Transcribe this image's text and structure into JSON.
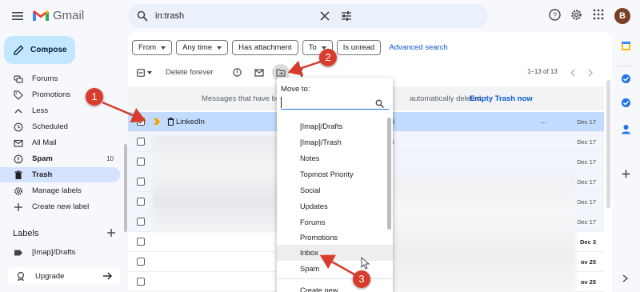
{
  "app": {
    "name": "Gmail",
    "avatar_letter": "B"
  },
  "search": {
    "query": "in:trash"
  },
  "compose": {
    "label": "Compose"
  },
  "sidebar": {
    "items": [
      {
        "label": "Forums",
        "icon": "forums-icon"
      },
      {
        "label": "Promotions",
        "icon": "tag-icon"
      },
      {
        "label": "Less",
        "icon": "chevron-up-icon"
      },
      {
        "label": "Scheduled",
        "icon": "schedule-icon"
      },
      {
        "label": "All Mail",
        "icon": "all-mail-icon"
      },
      {
        "label": "Spam",
        "icon": "spam-icon",
        "count": "10"
      },
      {
        "label": "Trash",
        "icon": "trash-icon"
      },
      {
        "label": "Manage labels",
        "icon": "gear-icon"
      },
      {
        "label": "Create new label",
        "icon": "plus-icon"
      }
    ],
    "labels_heading": "Labels",
    "label_items": [
      {
        "label": "[Imap]/Drafts",
        "icon": "label-icon"
      }
    ],
    "upgrade": "Upgrade"
  },
  "filters": {
    "from": "From",
    "any_time": "Any time",
    "has_attachment": "Has attachment",
    "to": "To",
    "is_unread": "Is unread",
    "advanced": "Advanced search"
  },
  "toolbar": {
    "delete_forever": "Delete forever",
    "pager": "1–13 of 13"
  },
  "banner": {
    "text_left": "Messages that have be",
    "text_right": "automatically deleted.",
    "empty_trash": "Empty Trash now"
  },
  "emails": [
    {
      "sender": "LinkedIn",
      "tail": "d",
      "ellipsis": "...",
      "date": "Dec 17",
      "selected": true
    },
    {
      "sender": "",
      "tail": "s",
      "date": "Dec 17"
    },
    {
      "sender": "",
      "tail": "",
      "date": "Dec 17"
    },
    {
      "sender": "",
      "tail": "",
      "date": "Dec 17"
    },
    {
      "sender": "",
      "tail": "",
      "date": "Dec 17"
    },
    {
      "sender": "",
      "tail": "",
      "date": "Dec 17"
    },
    {
      "sender": "",
      "tail": "",
      "date": "Dec 3",
      "unread": true
    },
    {
      "sender": "",
      "tail": "",
      "date": "ov 25",
      "unread": true
    },
    {
      "sender": "",
      "tail": "",
      "date": "ov 25",
      "unread": true
    }
  ],
  "move_to": {
    "heading": "Move to:",
    "items": [
      "[Imap]/Drafts",
      "[Imap]/Trash",
      "Notes",
      "Topmost Priority",
      "Social",
      "Updates",
      "Forums",
      "Promotions",
      "Inbox",
      "Spam",
      "Create new"
    ],
    "hovered": "Inbox"
  },
  "annotations": [
    "1",
    "2",
    "3"
  ],
  "colors": {
    "accent": "#0b57d0",
    "selected_row": "#c2dbff",
    "annotation": "#d93c2c"
  }
}
